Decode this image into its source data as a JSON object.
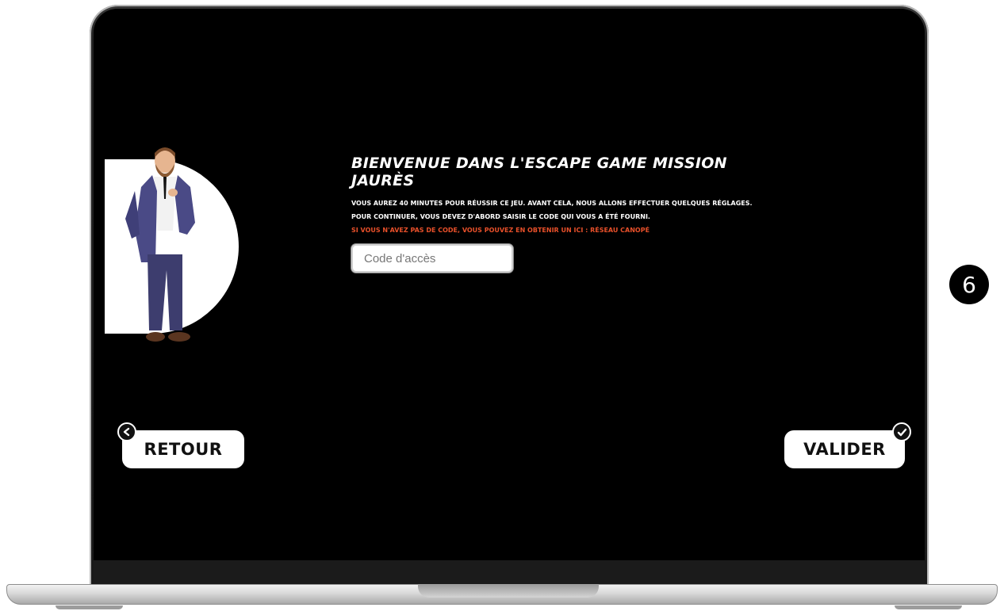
{
  "game": {
    "title": "BIENVENUE DANS L'ESCAPE GAME MISSION JAURÈS",
    "line1": "VOUS AUREZ 40 MINUTES POUR RÉUSSIR CE JEU. AVANT CELA, NOUS ALLONS EFFECTUER QUELQUES RÉGLAGES.",
    "line2": "POUR CONTINUER, VOUS DEVEZ D'ABORD SAISIR LE CODE QUI VOUS A ÉTÉ FOURNI.",
    "line3": "SI VOUS N'AVEZ PAS DE CODE, VOUS POUVEZ EN OBTENIR UN ICI : RÉSEAU CANOPÉ",
    "access_code": {
      "value": "",
      "placeholder": "Code d'accès"
    }
  },
  "buttons": {
    "back_label": "RETOUR",
    "validate_label": "VALIDER"
  },
  "step_badge": "6",
  "icons": {
    "back": "chevron-left-icon",
    "validate": "check-icon",
    "character": "character-illustration"
  },
  "colors": {
    "screen_bg": "#000000",
    "accent_red": "#e8502a",
    "text": "#ffffff"
  }
}
